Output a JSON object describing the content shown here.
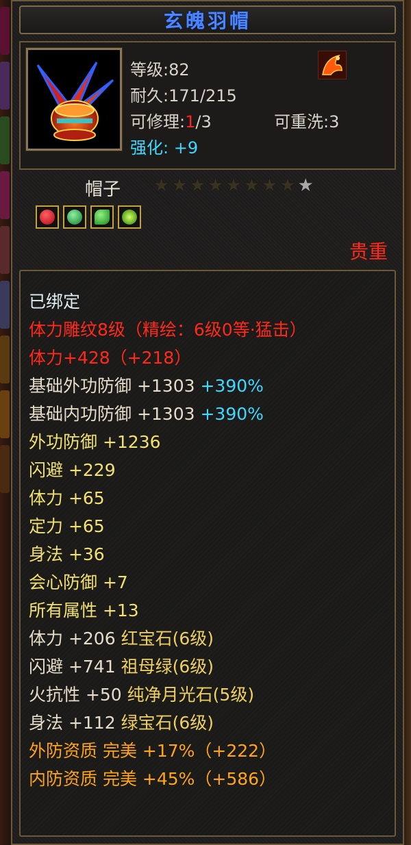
{
  "item": {
    "name": "玄魄羽帽",
    "level_label": "等级:82",
    "durability_label": "耐久:171/215",
    "repair_prefix": "可修理:",
    "repair_current": "1",
    "repair_suffix": "/3",
    "rewash_label": "可重洗:3",
    "enhance_label": "强化: +9",
    "type_label": "帽子",
    "rarity_label": "贵重",
    "stars_total": 9,
    "stars_lit": 1
  },
  "gems": [
    {
      "name": "red-gem-icon",
      "color": "#d0102a"
    },
    {
      "name": "green-leaf-gem-icon",
      "color": "#2aa048"
    },
    {
      "name": "green-jade-gem-icon",
      "color": "#36b040"
    },
    {
      "name": "green-round-gem-icon",
      "color": "#5ab81a"
    }
  ],
  "attributes": [
    {
      "parts": [
        {
          "text": "已绑定",
          "color": "white"
        }
      ]
    },
    {
      "parts": [
        {
          "text": "体力雕纹8级（精绘：6级0等·猛击）",
          "color": "red"
        }
      ]
    },
    {
      "parts": [
        {
          "text": "体力+428（+218）",
          "color": "red"
        }
      ]
    },
    {
      "parts": [
        {
          "text": "基础外功防御 +1303 ",
          "color": "beige"
        },
        {
          "text": "+390%",
          "color": "cyan"
        }
      ]
    },
    {
      "parts": [
        {
          "text": "基础内功防御 +1303 ",
          "color": "beige"
        },
        {
          "text": "+390%",
          "color": "cyan"
        }
      ]
    },
    {
      "parts": [
        {
          "text": "外功防御 +1236",
          "color": "yellow"
        }
      ]
    },
    {
      "parts": [
        {
          "text": "闪避 +229",
          "color": "yellow"
        }
      ]
    },
    {
      "parts": [
        {
          "text": "体力 +65",
          "color": "yellow"
        }
      ]
    },
    {
      "parts": [
        {
          "text": "定力 +65",
          "color": "yellow"
        }
      ]
    },
    {
      "parts": [
        {
          "text": "身法 +36",
          "color": "yellow"
        }
      ]
    },
    {
      "parts": [
        {
          "text": "会心防御 +7",
          "color": "yellow"
        }
      ]
    },
    {
      "parts": [
        {
          "text": "所有属性 +13",
          "color": "yellow"
        }
      ]
    },
    {
      "parts": [
        {
          "text": "体力 +206 ",
          "color": "beige"
        },
        {
          "text": "红宝石(6级)",
          "color": "gold"
        }
      ]
    },
    {
      "parts": [
        {
          "text": "闪避 +741 ",
          "color": "beige"
        },
        {
          "text": "祖母绿(6级)",
          "color": "gold"
        }
      ]
    },
    {
      "parts": [
        {
          "text": "火抗性 +50 ",
          "color": "beige"
        },
        {
          "text": "纯净月光石(5级)",
          "color": "gold"
        }
      ]
    },
    {
      "parts": [
        {
          "text": "身法 +112 ",
          "color": "beige"
        },
        {
          "text": "绿宝石(6级)",
          "color": "gold"
        }
      ]
    },
    {
      "parts": [
        {
          "text": "外防资质  完美 +17%（+222）",
          "color": "orange"
        }
      ]
    },
    {
      "parts": [
        {
          "text": "内防资质  完美 +45%（+586）",
          "color": "orange"
        }
      ]
    }
  ]
}
